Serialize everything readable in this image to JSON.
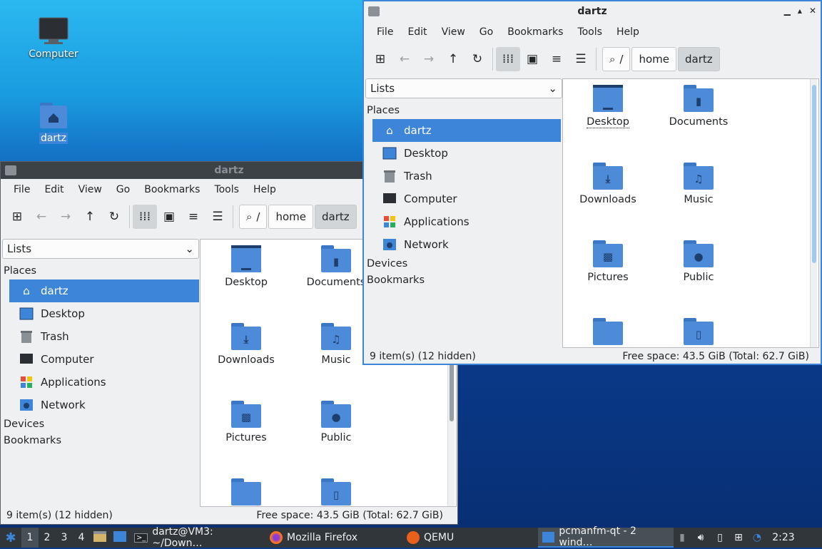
{
  "desktop": {
    "icons": [
      {
        "label": "Computer",
        "icon": "computer-icon"
      },
      {
        "label": "dartz",
        "icon": "home-folder-icon"
      }
    ]
  },
  "window_back": {
    "title": "dartz",
    "menu": [
      "File",
      "Edit",
      "View",
      "Go",
      "Bookmarks",
      "Tools",
      "Help"
    ],
    "path": [
      "/",
      "home",
      "dartz"
    ],
    "side_combo": "Lists",
    "places_header": "Places",
    "places": [
      "dartz",
      "Desktop",
      "Trash",
      "Computer",
      "Applications",
      "Network"
    ],
    "devices_header": "Devices",
    "bookmarks_header": "Bookmarks",
    "files": [
      "Desktop",
      "Documents",
      "Downloads",
      "Music",
      "Pictures",
      "Public"
    ],
    "status_left": "9 item(s) (12 hidden)",
    "status_right": "Free space: 43.5 GiB (Total: 62.7 GiB)"
  },
  "window_front": {
    "title": "dartz",
    "menu": [
      "File",
      "Edit",
      "View",
      "Go",
      "Bookmarks",
      "Tools",
      "Help"
    ],
    "path": [
      "/",
      "home",
      "dartz"
    ],
    "side_combo": "Lists",
    "places_header": "Places",
    "places": [
      "dartz",
      "Desktop",
      "Trash",
      "Computer",
      "Applications",
      "Network"
    ],
    "devices_header": "Devices",
    "bookmarks_header": "Bookmarks",
    "files": [
      "Desktop",
      "Documents",
      "Downloads",
      "Music",
      "Pictures",
      "Public"
    ],
    "status_left": "9 item(s) (12 hidden)",
    "status_right": "Free space: 43.5 GiB (Total: 62.7 GiB)"
  },
  "taskbar": {
    "workspaces": [
      "1",
      "2",
      "3",
      "4"
    ],
    "tasks": [
      "dartz@VM3: ~/Down…",
      "Mozilla Firefox",
      "QEMU",
      "pcmanfm-qt - 2 wind…"
    ],
    "clock": "2:23"
  },
  "colors": {
    "accent": "#3d85d8",
    "panel": "#31363b",
    "titlebar": "#475057"
  }
}
